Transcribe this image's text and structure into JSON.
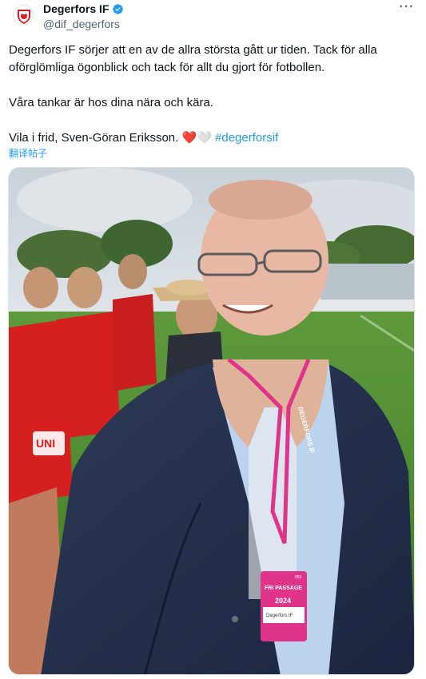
{
  "author": {
    "display_name": "Degerfors IF",
    "handle": "@dif_degerfors",
    "verified_icon": "verified-badge-icon",
    "avatar_icon": "club-crest-icon"
  },
  "more_icon": "more-options-icon",
  "tweet": {
    "line1": "Degerfors IF sörjer att en av de allra största gått ur tiden. Tack för alla oförglömliga ögonblick och tack för allt du gjort för fotbollen.",
    "line2": "Våra tankar är hos dina nära och kära.",
    "line3_prefix": "Vila i frid, Sven-Göran Eriksson. ",
    "heart_red": "❤️",
    "heart_white": "🤍",
    "hashtag": "#degerforsif"
  },
  "translate_label": "翻译帖子",
  "media": {
    "badge_title": "FRI PASSAGE",
    "badge_year": "2024",
    "badge_club": "Degerfors IF",
    "badge_number": "053",
    "shirt_text_1": "UNI",
    "lanyard_text": "DEGERFORS IF"
  },
  "colors": {
    "accent": "#1d9bf0",
    "club_red": "#d6201f",
    "badge_pink": "#e0338a"
  }
}
